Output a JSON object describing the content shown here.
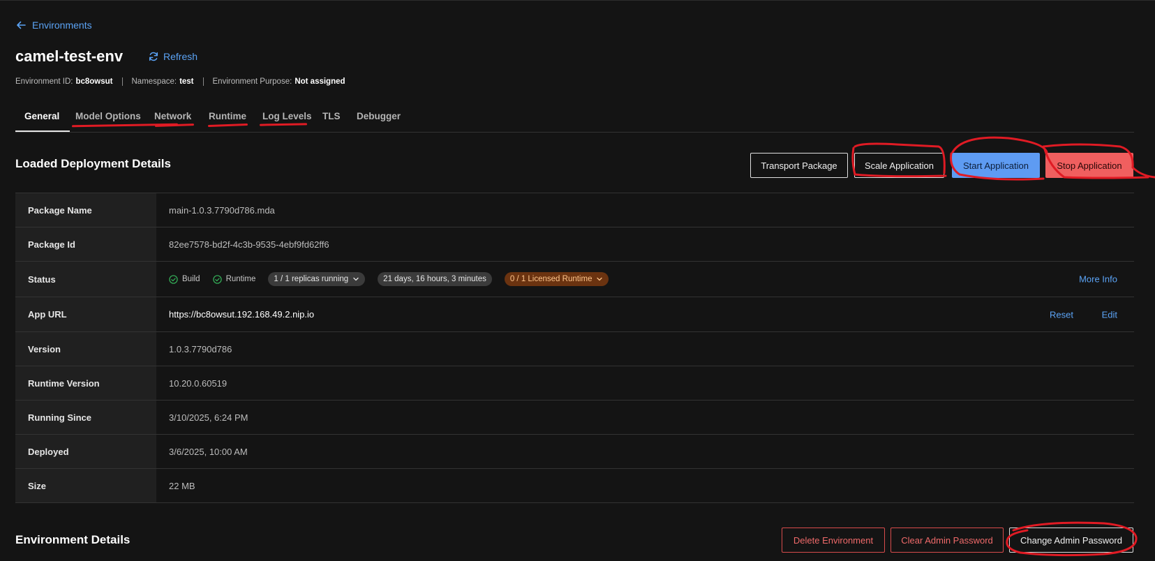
{
  "nav": {
    "back_label": "Environments"
  },
  "header": {
    "title": "camel-test-env",
    "refresh_label": "Refresh",
    "meta": [
      {
        "label": "Environment ID:",
        "value": "bc8owsut"
      },
      {
        "label": "Namespace:",
        "value": "test"
      },
      {
        "label": "Environment Purpose:",
        "value": "Not assigned"
      }
    ]
  },
  "tabs": [
    {
      "label": "General",
      "active": true
    },
    {
      "label": "Model Options",
      "active": false
    },
    {
      "label": "Network",
      "active": false
    },
    {
      "label": "Runtime",
      "active": false
    },
    {
      "label": "Log Levels",
      "active": false
    },
    {
      "label": "TLS",
      "active": false
    },
    {
      "label": "Debugger",
      "active": false
    }
  ],
  "deployment": {
    "title": "Loaded Deployment Details",
    "buttons": {
      "transport": "Transport Package",
      "scale": "Scale Application",
      "start": "Start Application",
      "stop": "Stop Application"
    },
    "rows": {
      "package_name": {
        "label": "Package Name",
        "value": "main-1.0.3.7790d786.mda"
      },
      "package_id": {
        "label": "Package Id",
        "value": "82ee7578-bd2f-4c3b-9535-4ebf9fd62ff6"
      },
      "status": {
        "label": "Status",
        "build": "Build",
        "runtime": "Runtime",
        "replicas": "1 / 1 replicas running",
        "uptime": "21 days, 16 hours, 3 minutes",
        "license": "0 / 1 Licensed Runtime",
        "more_info": "More Info"
      },
      "app_url": {
        "label": "App URL",
        "value": "https://bc8owsut.192.168.49.2.nip.io",
        "reset": "Reset",
        "edit": "Edit"
      },
      "version": {
        "label": "Version",
        "value": "1.0.3.7790d786"
      },
      "runtime_version": {
        "label": "Runtime Version",
        "value": "10.20.0.60519"
      },
      "running_since": {
        "label": "Running Since",
        "value": "3/10/2025, 6:24 PM"
      },
      "deployed": {
        "label": "Deployed",
        "value": "3/6/2025, 10:00 AM"
      },
      "size": {
        "label": "Size",
        "value": "22 MB"
      }
    }
  },
  "environment": {
    "title": "Environment Details",
    "buttons": {
      "delete": "Delete Environment",
      "clear_password": "Clear Admin Password",
      "change_password": "Change Admin Password"
    }
  },
  "colors": {
    "accent": "#5ba3f5",
    "primary_button": "#5e9bf2",
    "danger_button": "#f05f5f",
    "annotation": "#e01b24",
    "success": "#35b35a",
    "license_chip": "#6b3310"
  },
  "icons": {
    "back": "arrow-left-icon",
    "refresh": "refresh-icon",
    "check": "check-circle-icon",
    "dropdown": "chevron-down-icon"
  }
}
